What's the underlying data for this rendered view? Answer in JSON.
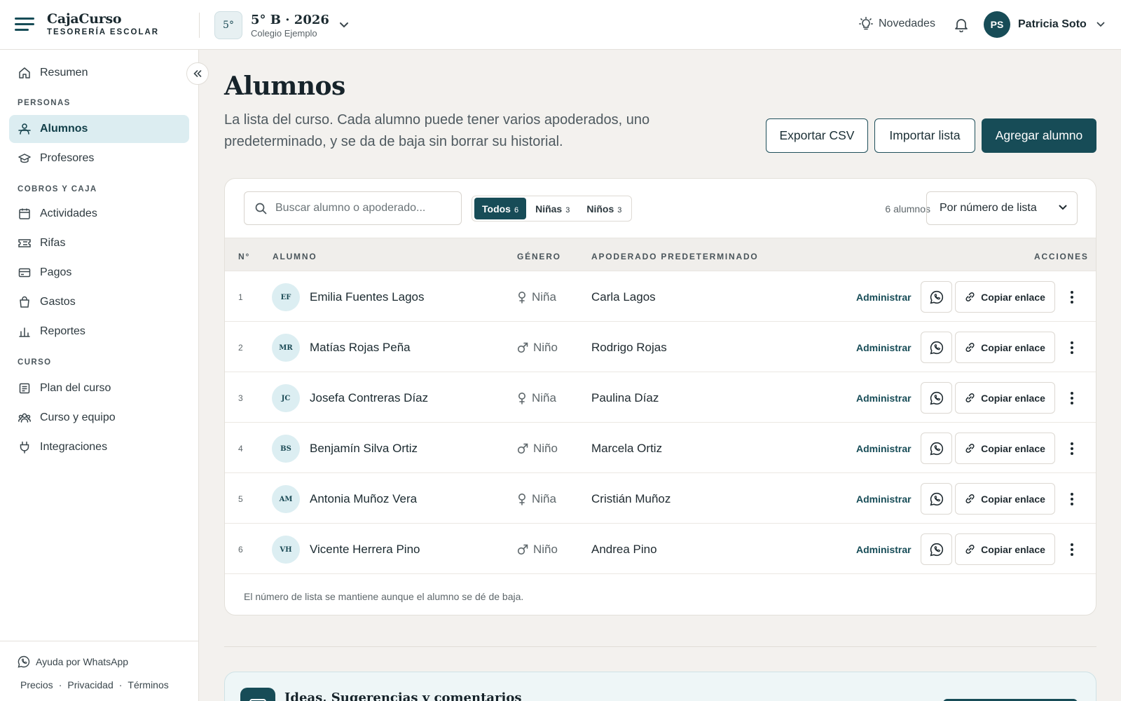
{
  "header": {
    "brand_name": "CajaCurso",
    "brand_sub": "TESORERÍA ESCOLAR",
    "course_badge": "5°",
    "course_title": "5° B · 2026",
    "course_school": "Colegio Ejemplo",
    "news_label": "Novedades",
    "user_initials": "PS",
    "user_name": "Patricia Soto"
  },
  "sidebar": {
    "summary": "Resumen",
    "section_people": "PERSONAS",
    "students": "Alumnos",
    "teachers": "Profesores",
    "section_money": "COBROS Y CAJA",
    "activities": "Actividades",
    "raffles": "Rifas",
    "payments": "Pagos",
    "expenses": "Gastos",
    "reports": "Reportes",
    "section_course": "CURSO",
    "plan": "Plan del curso",
    "team": "Curso y equipo",
    "integrations": "Integraciones",
    "help": "Ayuda por WhatsApp",
    "footer_links": [
      "Precios",
      "·",
      "Privacidad",
      "·",
      "Términos"
    ]
  },
  "page": {
    "title": "Alumnos",
    "description": "La lista del curso. Cada alumno puede tener varios apoderados, uno predeterminado, y se da de baja sin borrar su historial.",
    "export_label": "Exportar CSV",
    "import_label": "Importar lista",
    "add_label": "Agregar alumno"
  },
  "toolbar": {
    "search_placeholder": "Buscar alumno o apoderado...",
    "filters": [
      {
        "label": "Todos",
        "count": "6"
      },
      {
        "label": "Niñas",
        "count": "3"
      },
      {
        "label": "Niños",
        "count": "3"
      }
    ],
    "count_text": "6 alumnos",
    "sort_value": "Por número de lista"
  },
  "table": {
    "headers": {
      "num": "N°",
      "student": "ALUMNO",
      "gender": "GÉNERO",
      "guardian": "APODERADO PREDETERMINADO",
      "actions": "ACCIONES"
    },
    "admin_label": "Administrar",
    "copy_label": "Copiar enlace",
    "rows": [
      {
        "num": "1",
        "initials": "EF",
        "name": "Emilia Fuentes Lagos",
        "gender": "Niña",
        "guardian": "Carla Lagos"
      },
      {
        "num": "2",
        "initials": "MR",
        "name": "Matías Rojas Peña",
        "gender": "Niño",
        "guardian": "Rodrigo Rojas"
      },
      {
        "num": "3",
        "initials": "JC",
        "name": "Josefa Contreras Díaz",
        "gender": "Niña",
        "guardian": "Paulina Díaz"
      },
      {
        "num": "4",
        "initials": "BS",
        "name": "Benjamín Silva Ortiz",
        "gender": "Niño",
        "guardian": "Marcela Ortiz"
      },
      {
        "num": "5",
        "initials": "AM",
        "name": "Antonia Muñoz Vera",
        "gender": "Niña",
        "guardian": "Cristián Muñoz"
      },
      {
        "num": "6",
        "initials": "VH",
        "name": "Vicente Herrera Pino",
        "gender": "Niño",
        "guardian": "Andrea Pino"
      }
    ],
    "footer_note": "El número de lista se mantiene aunque el alumno se dé de baja."
  },
  "ideas": {
    "title": "Ideas, Sugerencias y comentarios"
  },
  "colors": {
    "primary": "#174c57",
    "active_nav_bg": "#dcedf1",
    "page_bg": "#f3f1ee"
  },
  "icons": {
    "menu": "menu-icon",
    "bell": "bell-icon",
    "news": "lightbulb-icon",
    "whatsapp": "whatsapp-icon",
    "link": "link-icon",
    "more": "more-vertical-icon"
  }
}
